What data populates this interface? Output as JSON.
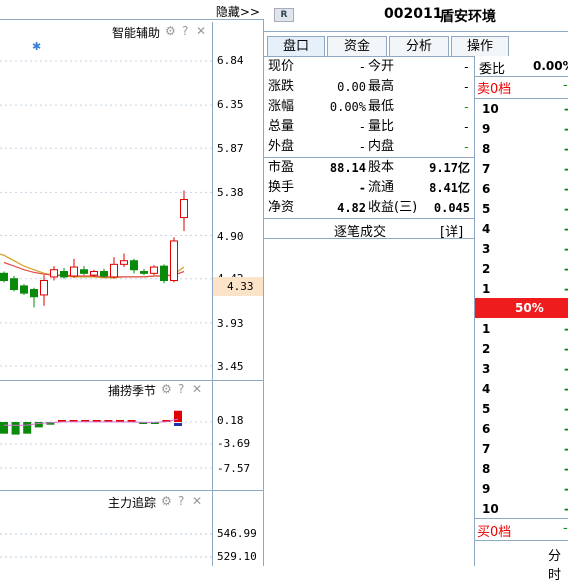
{
  "header": {
    "hide_label": "隐藏>>",
    "r_badge": "R",
    "stock_code": "002011",
    "stock_name": "盾安环境"
  },
  "panes": {
    "main": {
      "title": "智能辅助",
      "axis": [
        "6.84",
        "6.35",
        "5.87",
        "5.38",
        "4.90",
        "4.42",
        "3.93",
        "3.45"
      ],
      "current": "4.33"
    },
    "second": {
      "title": "捕捞季节",
      "axis": [
        "0.18",
        "-3.69",
        "-7.57"
      ]
    },
    "third": {
      "title": "主力追踪",
      "axis": [
        "546.99",
        "529.10"
      ]
    },
    "icon_glyphs": {
      "gear": "⚙",
      "help": "?",
      "close": "✕"
    }
  },
  "tabs": [
    "盘口",
    "资金",
    "分析",
    "操作"
  ],
  "quote": {
    "rows1": [
      {
        "l1": "现价",
        "v1": "-",
        "l2": "今开",
        "v2": "-"
      },
      {
        "l1": "涨跌",
        "v1": "0.00",
        "l2": "最高",
        "v2": "-"
      },
      {
        "l1": "涨幅",
        "v1": "0.00%",
        "l2": "最低",
        "v2": "-"
      },
      {
        "l1": "总量",
        "v1": "-",
        "l2": "量比",
        "v2": "-"
      },
      {
        "l1": "外盘",
        "v1": "-",
        "l2": "内盘",
        "v2": "-"
      }
    ],
    "rows2": [
      {
        "l1": "市盈",
        "v1": "88.14",
        "l2": "股本",
        "v2": "9.17亿"
      },
      {
        "l1": "换手",
        "v1": "-",
        "l2": "流通",
        "v2": "8.41亿"
      },
      {
        "l1": "净资",
        "v1": "4.82",
        "l2": "收益(三)",
        "v2": "0.045"
      }
    ],
    "trade_label": "逐笔成交",
    "detail_label": "[详]"
  },
  "orderbook": {
    "ratio_label": "委比",
    "ratio_value": "0.00%",
    "sell_label": "卖0档",
    "sell_levels": [
      "10",
      "9",
      "8",
      "7",
      "6",
      "5",
      "4",
      "3",
      "2",
      "1"
    ],
    "mid_pct": "50%",
    "buy_levels": [
      "1",
      "2",
      "3",
      "4",
      "5",
      "6",
      "7",
      "8",
      "9",
      "10"
    ],
    "buy_label": "买0档",
    "dash": "-",
    "bottom_tab": "分时"
  },
  "colors": {
    "up": "#e00000",
    "down": "#0a8a0a",
    "axis": "#8fa9c2",
    "ma1": "#d4a020",
    "ma2": "#e05050"
  },
  "chart_data": {
    "type": "candlestick",
    "ylim": [
      3.45,
      6.84
    ],
    "candles": [
      {
        "o": 4.48,
        "c": 4.4,
        "h": 4.5,
        "l": 4.38
      },
      {
        "o": 4.42,
        "c": 4.3,
        "h": 4.45,
        "l": 4.28
      },
      {
        "o": 4.34,
        "c": 4.26,
        "h": 4.36,
        "l": 4.24
      },
      {
        "o": 4.3,
        "c": 4.22,
        "h": 4.32,
        "l": 4.1
      },
      {
        "o": 4.24,
        "c": 4.4,
        "h": 4.46,
        "l": 4.12
      },
      {
        "o": 4.44,
        "c": 4.52,
        "h": 4.56,
        "l": 4.4
      },
      {
        "o": 4.5,
        "c": 4.44,
        "h": 4.54,
        "l": 4.42
      },
      {
        "o": 4.45,
        "c": 4.55,
        "h": 4.64,
        "l": 4.43
      },
      {
        "o": 4.52,
        "c": 4.48,
        "h": 4.56,
        "l": 4.46
      },
      {
        "o": 4.46,
        "c": 4.5,
        "h": 4.52,
        "l": 4.44
      },
      {
        "o": 4.5,
        "c": 4.45,
        "h": 4.53,
        "l": 4.43
      },
      {
        "o": 4.44,
        "c": 4.58,
        "h": 4.66,
        "l": 4.42
      },
      {
        "o": 4.58,
        "c": 4.62,
        "h": 4.7,
        "l": 4.55
      },
      {
        "o": 4.62,
        "c": 4.52,
        "h": 4.64,
        "l": 4.48
      },
      {
        "o": 4.5,
        "c": 4.48,
        "h": 4.53,
        "l": 4.46
      },
      {
        "o": 4.48,
        "c": 4.55,
        "h": 4.57,
        "l": 4.46
      },
      {
        "o": 4.56,
        "c": 4.4,
        "h": 4.58,
        "l": 4.37
      },
      {
        "o": 4.4,
        "c": 4.84,
        "h": 4.88,
        "l": 4.38
      },
      {
        "o": 5.1,
        "c": 5.3,
        "h": 5.4,
        "l": 4.95
      }
    ],
    "ma1": [
      4.68,
      4.62,
      4.56,
      4.52,
      4.48,
      4.46,
      4.45,
      4.44,
      4.44,
      4.44,
      4.43,
      4.43,
      4.44,
      4.44,
      4.44,
      4.45,
      4.45,
      4.47,
      4.55
    ],
    "ma2": [
      4.6,
      4.56,
      4.52,
      4.49,
      4.47,
      4.46,
      4.46,
      4.45,
      4.45,
      4.45,
      4.44,
      4.44,
      4.44,
      4.44,
      4.44,
      4.45,
      4.45,
      4.46,
      4.5
    ],
    "indicator": [
      -2.6,
      -2.8,
      -2.6,
      -1.2,
      -0.6,
      0.1,
      0.2,
      0.2,
      0.1,
      0.1,
      0.0,
      0.0,
      -0.3,
      -0.3,
      0.2,
      2.5
    ]
  }
}
